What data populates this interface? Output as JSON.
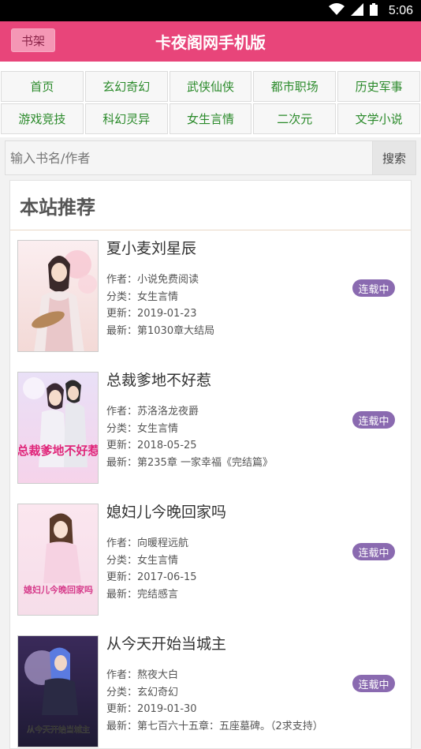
{
  "statusbar": {
    "time": "5:06"
  },
  "header": {
    "shelf_label": "书架",
    "title": "卡夜阁网手机版"
  },
  "nav": {
    "items": [
      {
        "label": "首页"
      },
      {
        "label": "玄幻奇幻"
      },
      {
        "label": "武侠仙侠"
      },
      {
        "label": "都市职场"
      },
      {
        "label": "历史军事"
      },
      {
        "label": "游戏竞技"
      },
      {
        "label": "科幻灵异"
      },
      {
        "label": "女生言情"
      },
      {
        "label": "二次元"
      },
      {
        "label": "文学小说"
      }
    ]
  },
  "search": {
    "placeholder": "输入书名/作者",
    "button_label": "搜索"
  },
  "recommend": {
    "title": "本站推荐",
    "labels": {
      "author": "作者：",
      "category": "分类：",
      "updated": "更新：",
      "latest": "最新："
    },
    "books": [
      {
        "title": "夏小麦刘星辰",
        "author": "小说免费阅读",
        "category": "女生言情",
        "updated": "2019-01-23",
        "latest": "第1030章大结局",
        "status": "连载中"
      },
      {
        "title": "总裁爹地不好惹",
        "author": "苏洛洛龙夜爵",
        "category": "女生言情",
        "updated": "2018-05-25",
        "latest": "第235章 一家幸福《完结篇》",
        "status": "连载中"
      },
      {
        "title": "媳妇儿今晚回家吗",
        "author": "向暖程远航",
        "category": "女生言情",
        "updated": "2017-06-15",
        "latest": "完结感言",
        "status": "连载中"
      },
      {
        "title": "从今天开始当城主",
        "author": "熬夜大白",
        "category": "玄幻奇幻",
        "updated": "2019-01-30",
        "latest": "第七百六十五章：五座墓碑。（2求支持）",
        "status": "连载中"
      }
    ],
    "cover_texts": [
      "总裁爹地不好惹",
      "媳妇儿今晚回家吗",
      "从今天开始当城主"
    ]
  },
  "colors": {
    "header": "#e8457a",
    "badge": "#8a6ab0",
    "nav_text": "#2a8a2a"
  }
}
